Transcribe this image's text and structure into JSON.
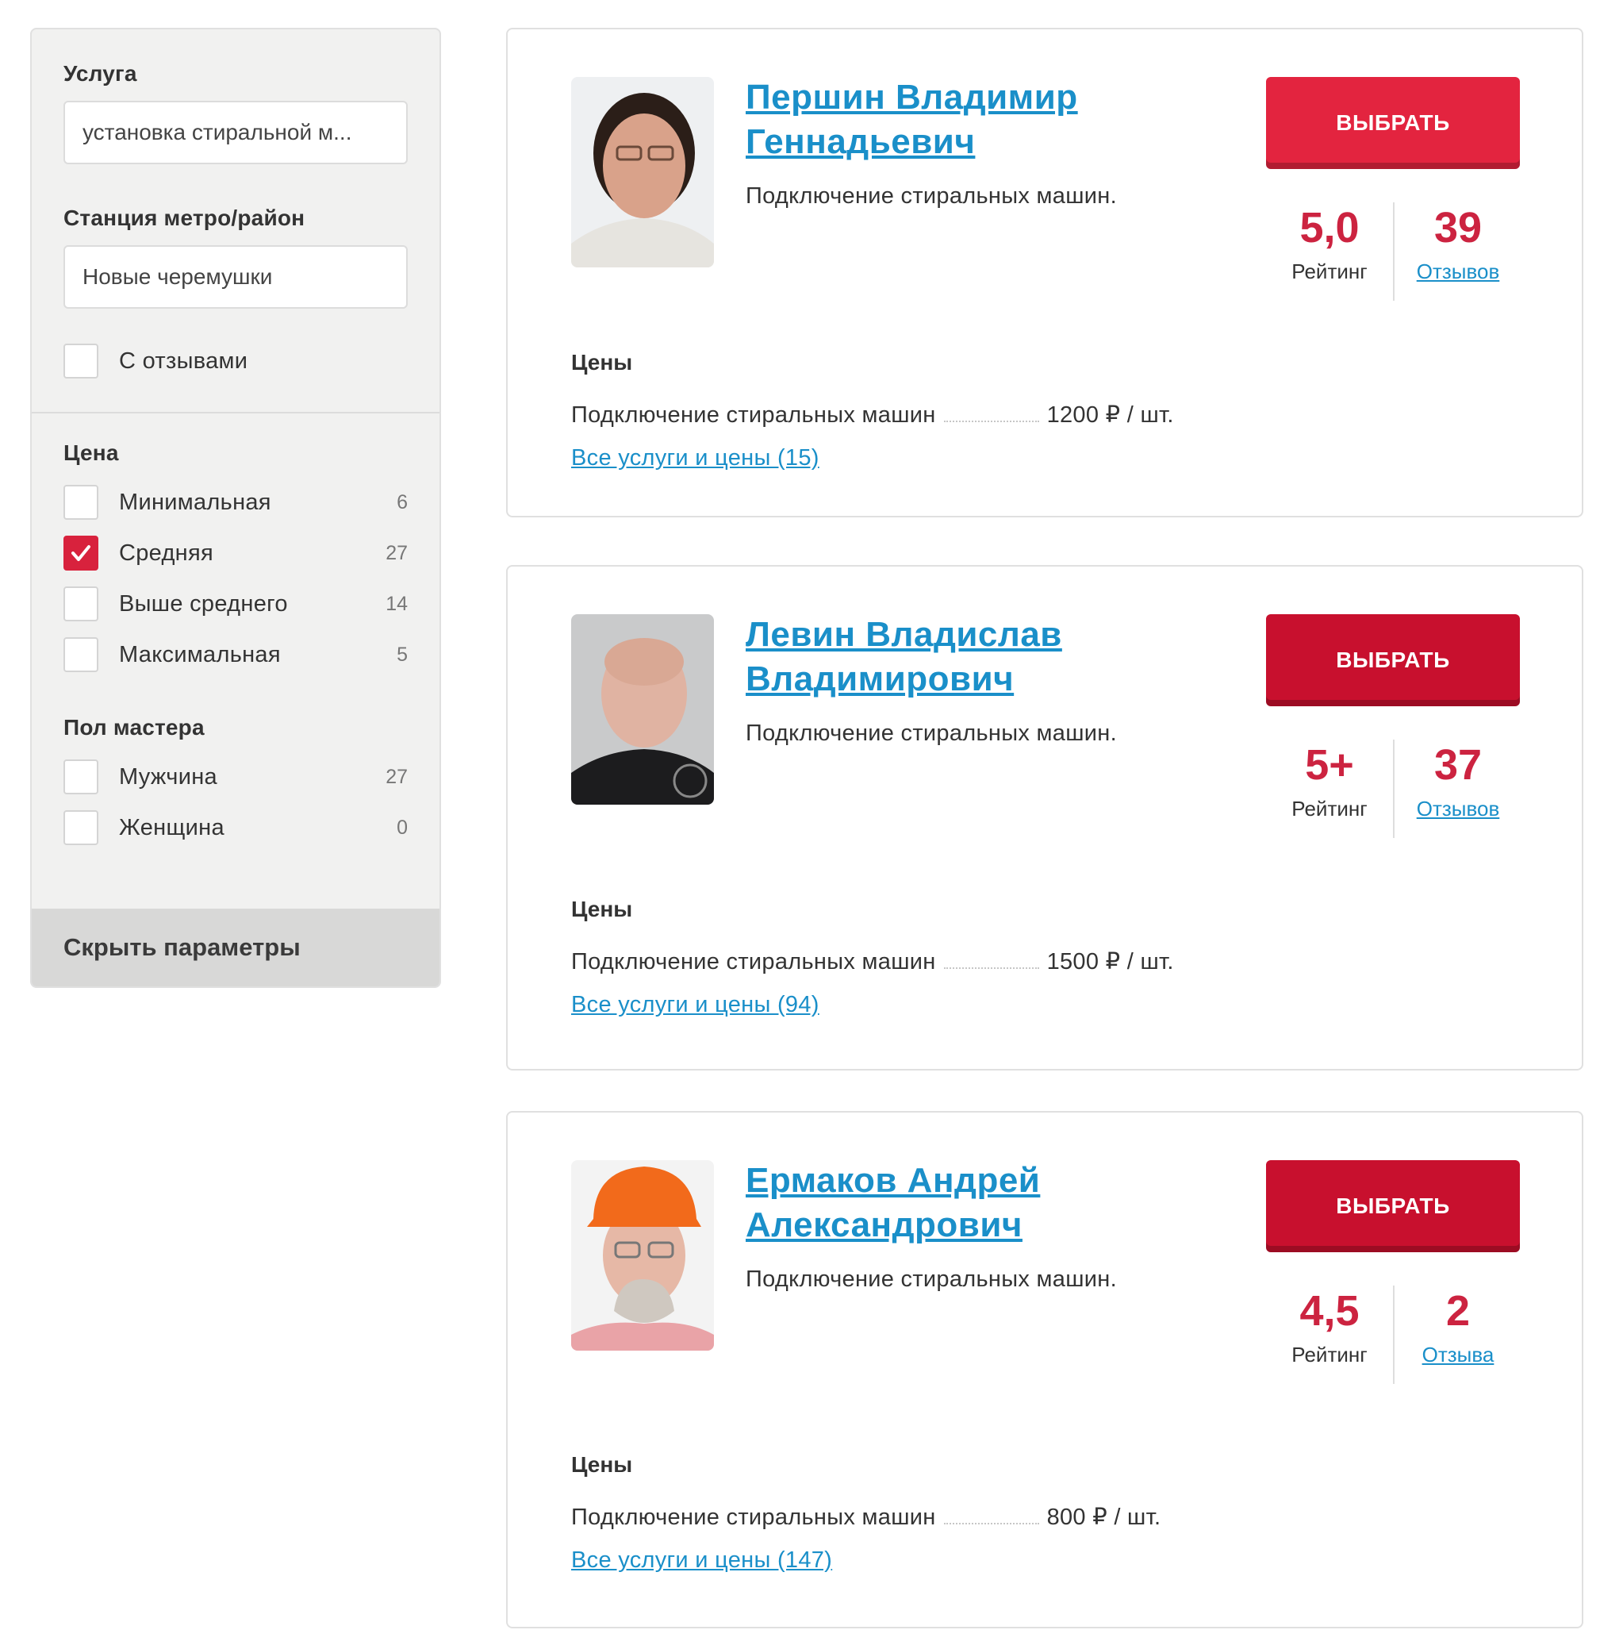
{
  "filters": {
    "service": {
      "label": "Услуга",
      "value": "установка стиральной м..."
    },
    "metro": {
      "label": "Станция метро/район",
      "value": "Новые черемушки"
    },
    "with_reviews": {
      "label": "С отзывами",
      "checked": false
    },
    "price": {
      "label": "Цена",
      "options": [
        {
          "label": "Минимальная",
          "count": "6",
          "checked": false
        },
        {
          "label": "Средняя",
          "count": "27",
          "checked": true
        },
        {
          "label": "Выше среднего",
          "count": "14",
          "checked": false
        },
        {
          "label": "Максимальная",
          "count": "5",
          "checked": false
        }
      ]
    },
    "gender": {
      "label": "Пол мастера",
      "options": [
        {
          "label": "Мужчина",
          "count": "27",
          "checked": false
        },
        {
          "label": "Женщина",
          "count": "0",
          "checked": false
        }
      ]
    },
    "hide_label": "Скрыть параметры"
  },
  "masters": [
    {
      "name_line1": "Першин Владимир",
      "name_line2": "Геннадьевич",
      "subtitle": "Подключение стиральных машин.",
      "button": "ВЫБРАТЬ",
      "button_color": "#e3243f",
      "rating": "5,0",
      "rating_label": "Рейтинг",
      "reviews": "39",
      "reviews_label": "Отзывов",
      "prices_heading": "Цены",
      "price_service": "Подключение стиральных машин",
      "price_value": "1200 ₽ / шт.",
      "all_link": "Все услуги и цены (15)"
    },
    {
      "name_line1": "Левин Владислав",
      "name_line2": "Владимирович",
      "subtitle": "Подключение стиральных машин.",
      "button": "ВЫБРАТЬ",
      "button_color": "#c8102e",
      "rating": "5+",
      "rating_label": "Рейтинг",
      "reviews": "37",
      "reviews_label": "Отзывов",
      "prices_heading": "Цены",
      "price_service": "Подключение стиральных машин",
      "price_value": "1500 ₽ / шт.",
      "all_link": "Все услуги и цены (94)"
    },
    {
      "name_line1": "Ермаков Андрей",
      "name_line2": "Александрович",
      "subtitle": "Подключение стиральных машин.",
      "button": "ВЫБРАТЬ",
      "button_color": "#c8102e",
      "rating": "4,5",
      "rating_label": "Рейтинг",
      "reviews": "2",
      "reviews_label": "Отзыва",
      "prices_heading": "Цены",
      "price_service": "Подключение стиральных машин",
      "price_value": "800 ₽ / шт.",
      "all_link": "Все услуги и цены (147)"
    }
  ],
  "colors": {
    "accent_red": "#cc2340",
    "link_blue": "#1a8fc9",
    "sidebar_bg": "#f1f1f0"
  }
}
